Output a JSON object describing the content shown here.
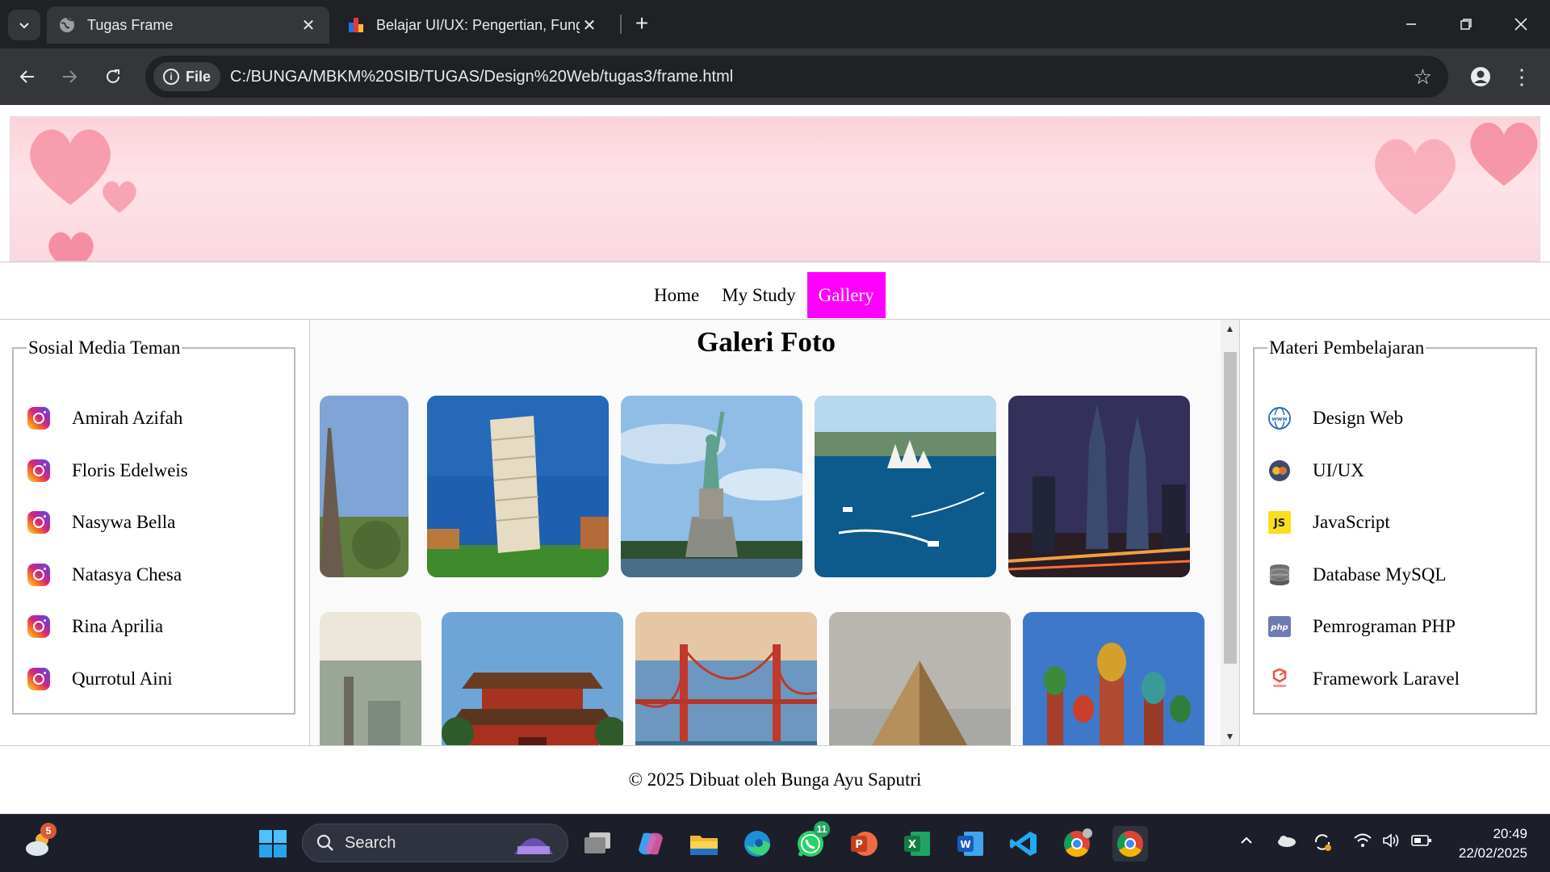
{
  "browser": {
    "tabs": [
      {
        "title": "Tugas Frame",
        "active": true
      },
      {
        "title": "Belajar UI/UX: Pengertian, Fungsi",
        "active": false
      }
    ],
    "site_chip": "File",
    "url": "C:/BUNGA/MBKM%20SIB/TUGAS/Design%20Web/tugas3/frame.html"
  },
  "page": {
    "nav": [
      {
        "label": "Home"
      },
      {
        "label": "My Study"
      },
      {
        "label": "Gallery"
      }
    ],
    "left_box": {
      "title": "Sosial Media Teman",
      "items": [
        {
          "label": "Amirah Azifah",
          "icon": "instagram-icon"
        },
        {
          "label": "Floris Edelweis",
          "icon": "instagram-icon"
        },
        {
          "label": "Nasywa Bella",
          "icon": "instagram-icon"
        },
        {
          "label": "Natasya Chesa",
          "icon": "instagram-icon"
        },
        {
          "label": "Rina Aprilia",
          "icon": "instagram-icon"
        },
        {
          "label": "Qurrotul Aini",
          "icon": "instagram-icon"
        }
      ]
    },
    "right_box": {
      "title": "Materi Pembelajaran",
      "items": [
        {
          "label": "Design Web",
          "icon": "www-globe-icon"
        },
        {
          "label": "UI/UX",
          "icon": "uiux-icon"
        },
        {
          "label": "JavaScript",
          "icon": "javascript-icon"
        },
        {
          "label": "Database MySQL",
          "icon": "database-icon"
        },
        {
          "label": "Pemrograman PHP",
          "icon": "php-icon"
        },
        {
          "label": "Framework Laravel",
          "icon": "laravel-icon"
        }
      ]
    },
    "gallery": {
      "title": "Galeri Foto",
      "photos": [
        {
          "name": "eiffel-tower-photo"
        },
        {
          "name": "leaning-tower-of-pisa-photo"
        },
        {
          "name": "statue-of-liberty-photo"
        },
        {
          "name": "sydney-opera-house-photo"
        },
        {
          "name": "petronas-towers-photo"
        },
        {
          "name": "london-city-photo"
        },
        {
          "name": "forbidden-city-photo"
        },
        {
          "name": "golden-gate-bridge-photo"
        },
        {
          "name": "pyramid-photo"
        },
        {
          "name": "st-basils-cathedral-photo"
        }
      ]
    },
    "footer": "© 2025 Dibuat oleh Bunga Ayu Saputri"
  },
  "taskbar": {
    "weather_badge": "5",
    "search_placeholder": "Search",
    "whatsapp_badge": "11",
    "time": "20:49",
    "date": "22/02/2025"
  },
  "colors": {
    "nav_active": "#ff00ff",
    "chrome_dark": "#202124",
    "chrome_toolbar": "#35363a"
  }
}
